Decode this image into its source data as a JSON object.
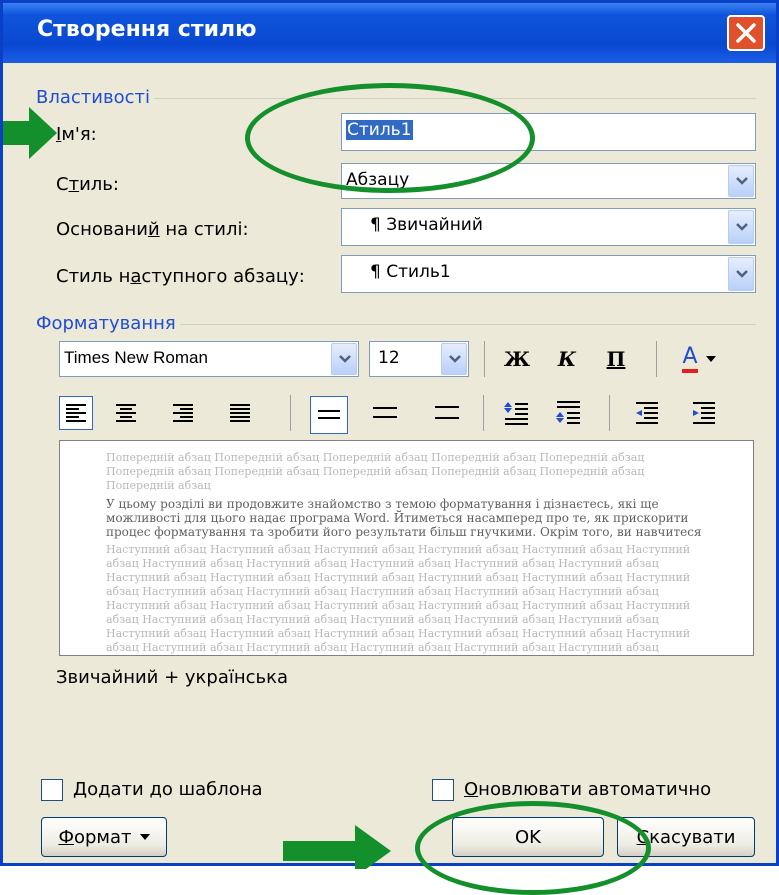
{
  "window": {
    "title": "Створення стилю"
  },
  "properties": {
    "group_label": "Властивості",
    "name": {
      "label_prefix": "І",
      "label_rest": "м'я:",
      "value": "Стиль1"
    },
    "style_type": {
      "label_prefix": "С",
      "label_u": "т",
      "label_rest": "иль:",
      "value": "Абзацу"
    },
    "based_on": {
      "label_prefix": "Основани",
      "label_u": "й",
      "label_rest": " на стилі:",
      "value": "¶ Звичайний"
    },
    "next_style": {
      "label_prefix": "Стиль н",
      "label_u": "а",
      "label_rest": "ступного абзацу:",
      "value": "¶ Стиль1"
    }
  },
  "formatting": {
    "group_label": "Форматування",
    "font": "Times New Roman",
    "size": "12",
    "bold": "Ж",
    "italic": "К",
    "underline": "П",
    "font_color_letter": "А",
    "font_color": "#E02020"
  },
  "preview": {
    "prev_para": "Попередній абзац Попередній абзац Попередній абзац Попередній абзац Попередній абзац Попередній абзац Попередній абзац Попередній абзац Попередній абзац Попередній абзац Попередній абзац",
    "current_text": "У цьому розділі ви продовжите знайомство з темою форматування і дізнаєтесь, які ще можливості для цього надає програма Word. Йтиметься насамперед про те, як прискорити процес форматування та зробити його результати більш гнучкими. Окрім того, ви навчитеся",
    "next_para": "Наступний абзац Наступний абзац Наступний абзац Наступний абзац Наступний абзац Наступний абзац Наступний абзац Наступний абзац Наступний абзац Наступний абзац Наступний абзац Наступний абзац Наступний абзац Наступний абзац Наступний абзац Наступний абзац Наступний абзац Наступний абзац Наступний абзац Наступний абзац Наступний абзац Наступний абзац Наступний абзац Наступний абзац Наступний абзац Наступний абзац Наступний абзац Наступний абзац Наступний абзац Наступний абзац Наступний абзац Наступний абзац Наступний абзац Наступний абзац Наступний абзац Наступний абзац Наступний абзац Наступний абзац Наступний абзац Наступний абзац Наступний абзац Наступний абзац Наступний абзац Наступний абзац Наступний абзац Наступний абзац Наступний абзац Наступний абзац Наступний абзац Наступний абзац Наступний абзац Наступний абзац Наступний абзац Наступний абзац Наступний абзац Наступний абзац Наступний абзац Наступний абзац Наступний абзац Наступний абзац"
  },
  "description": "Звичайний + українська",
  "options": {
    "add_to_template": {
      "u": "Д",
      "rest": "одати до шаблона",
      "checked": false
    },
    "auto_update": {
      "u": "О",
      "rest": "новлювати автоматично",
      "checked": false
    }
  },
  "buttons": {
    "format_u": "Ф",
    "format_rest": "ормат",
    "ok": "OK",
    "cancel_u": "С",
    "cancel_rest": "касувати"
  },
  "annotations": {
    "color": "#138F2C"
  }
}
